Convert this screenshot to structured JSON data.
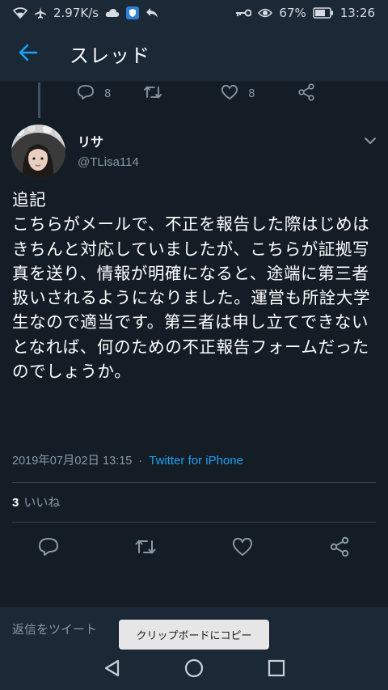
{
  "status_bar": {
    "network_speed": "2.97K/s",
    "battery": "67%",
    "time": "13:26",
    "icons": [
      "wifi-icon",
      "airplane-icon",
      "cloud-icon",
      "shield-icon",
      "reply-arrow-icon",
      "key-icon",
      "eye-icon",
      "battery-icon"
    ]
  },
  "app_bar": {
    "title": "スレッド",
    "back_icon": "back-arrow-icon"
  },
  "previous_tweet_actions": {
    "reply_count": "8",
    "like_count": "8"
  },
  "tweet": {
    "author_name": "リサ",
    "author_handle": "@TLisa114",
    "text": "追記\nこちらがメールで、不正を報告した際はじめはきちんと対応していましたが、こちらが証拠写真を送り、情報が明確になると、途端に第三者扱いされるようになりました。運営も所詮大学生なので適当です。第三者は申し立てできないとなれば、何のための不正報告フォームだったのでしょうか。",
    "timestamp": "2019年07月02日 13:15",
    "separator": "·",
    "client": "Twitter for iPhone",
    "likes_count": "3",
    "likes_label": "いいね"
  },
  "reply": {
    "placeholder": "返信をツイート"
  },
  "toast": {
    "message": "クリップボードにコピー"
  },
  "colors": {
    "background": "#141d26",
    "bar": "#1b2836",
    "accent": "#1da1f2",
    "muted": "#8899a6",
    "divider": "#38444d"
  }
}
